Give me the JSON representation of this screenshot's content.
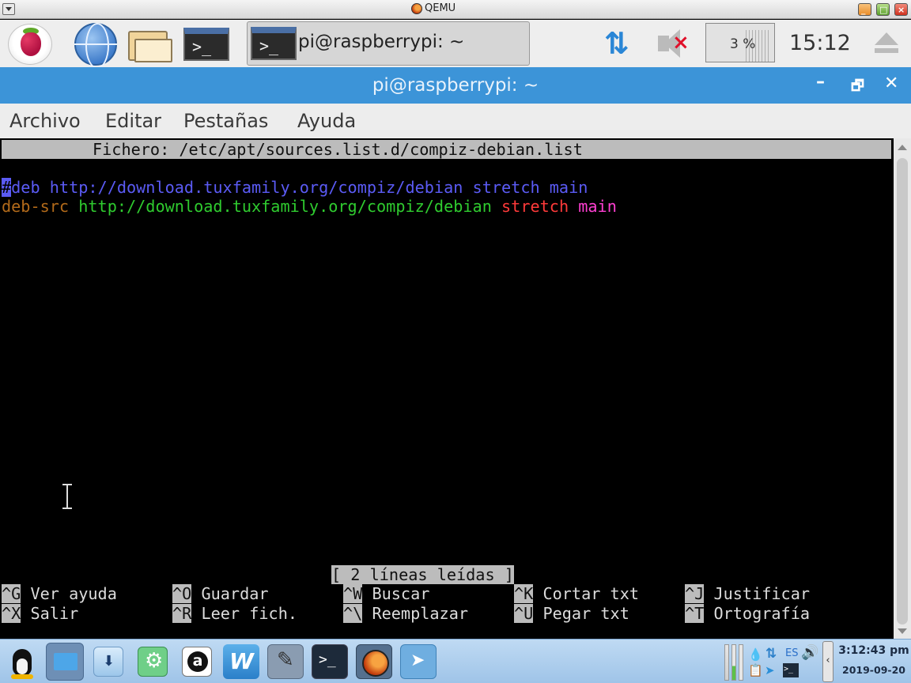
{
  "qemu": {
    "title": "QEMU"
  },
  "panel": {
    "task_label": "pi@raspberrypi: ~",
    "cpu_percent": "3 %",
    "clock": "15:12"
  },
  "window": {
    "title": "pi@raspberrypi: ~",
    "menu": [
      "Archivo",
      "Editar",
      "Pestañas",
      "Ayuda"
    ]
  },
  "nano": {
    "header": "Fichero: /etc/apt/sources.list.d/compiz-debian.list",
    "line1": {
      "cursor": "#",
      "text": "deb http://download.tuxfamily.org/compiz/debian stretch main"
    },
    "line2": {
      "type": "deb-src",
      "url": "http://download.tuxfamily.org/compiz/debian",
      "dist": "stretch",
      "component": "main"
    },
    "status": "[ 2 líneas leídas ]",
    "shortcuts_row1": [
      {
        "key": "^G",
        "label": "Ver ayuda"
      },
      {
        "key": "^O",
        "label": "Guardar"
      },
      {
        "key": "^W",
        "label": "Buscar"
      },
      {
        "key": "^K",
        "label": "Cortar txt"
      },
      {
        "key": "^J",
        "label": "Justificar"
      }
    ],
    "shortcuts_row2": [
      {
        "key": "^X",
        "label": "Salir"
      },
      {
        "key": "^R",
        "label": "Leer fich."
      },
      {
        "key": "^\\",
        "label": "Reemplazar"
      },
      {
        "key": "^U",
        "label": "Pegar txt"
      },
      {
        "key": "^T",
        "label": "Ortografía"
      }
    ]
  },
  "host_taskbar": {
    "lang": "ES",
    "time": "3:12:43 pm",
    "date": "2019-09-20"
  }
}
